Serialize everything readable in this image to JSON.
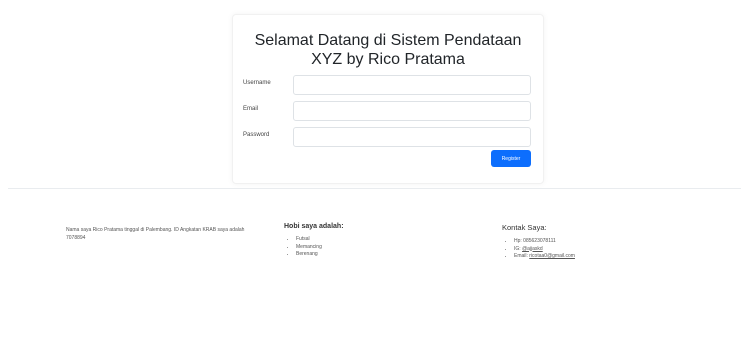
{
  "form": {
    "title": "Selamat Datang di Sistem Pendataan XYZ by Rico Pratama",
    "fields": {
      "username": {
        "label": "Username",
        "value": "",
        "placeholder": ""
      },
      "email": {
        "label": "Email",
        "value": "",
        "placeholder": ""
      },
      "password": {
        "label": "Password",
        "value": "",
        "placeholder": ""
      }
    },
    "submit_label": "Register"
  },
  "footer": {
    "about": {
      "text": "Nama saya Rico Pratama tinggal di Palembang. ID Angkatan KRAB saya adalah 7078894"
    },
    "hobby": {
      "heading": "Hobi saya adalah:",
      "items": [
        "Futsal",
        "Memancing",
        "Berenang"
      ]
    },
    "contact": {
      "heading": "Kontak Saya:",
      "items": {
        "phone_prefix": "Hp: ",
        "phone": "085623078111",
        "ig_prefix": "IG: ",
        "ig": "@ajjaskd",
        "email_prefix": "Email: ",
        "email": "ricotaa0@gmail.com"
      }
    }
  },
  "colors": {
    "primary": "#0d6efd",
    "divider": "#e9ecef",
    "text": "#212529"
  }
}
